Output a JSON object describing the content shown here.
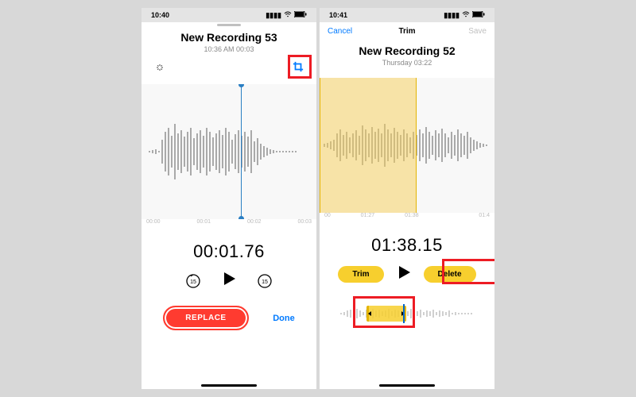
{
  "left": {
    "status": {
      "time": "10:40",
      "signal": "●●●●",
      "wifi": "wifi",
      "battery": "90%"
    },
    "title": "New Recording 53",
    "subtitle": "10:36 AM   00:03",
    "ruler": [
      "00:00",
      "00:01",
      "00:02",
      "00:03"
    ],
    "big_time": "00:01.76",
    "skip_val": "15",
    "replace": "REPLACE",
    "done": "Done"
  },
  "right": {
    "status": {
      "time": "10:41"
    },
    "nav": {
      "cancel": "Cancel",
      "title": "Trim",
      "save": "Save"
    },
    "title": "New Recording 52",
    "subtitle": "Thursday   03:22",
    "ruler": [
      "00",
      "01:27",
      "01:38",
      "",
      "01:4"
    ],
    "big_time": "01:38.15",
    "trim": "Trim",
    "delete": "Delete"
  },
  "colors": {
    "accent": "#007aff",
    "red": "#ff3b30",
    "yellow": "#f7cf2e",
    "hl": "#ed1c24"
  }
}
